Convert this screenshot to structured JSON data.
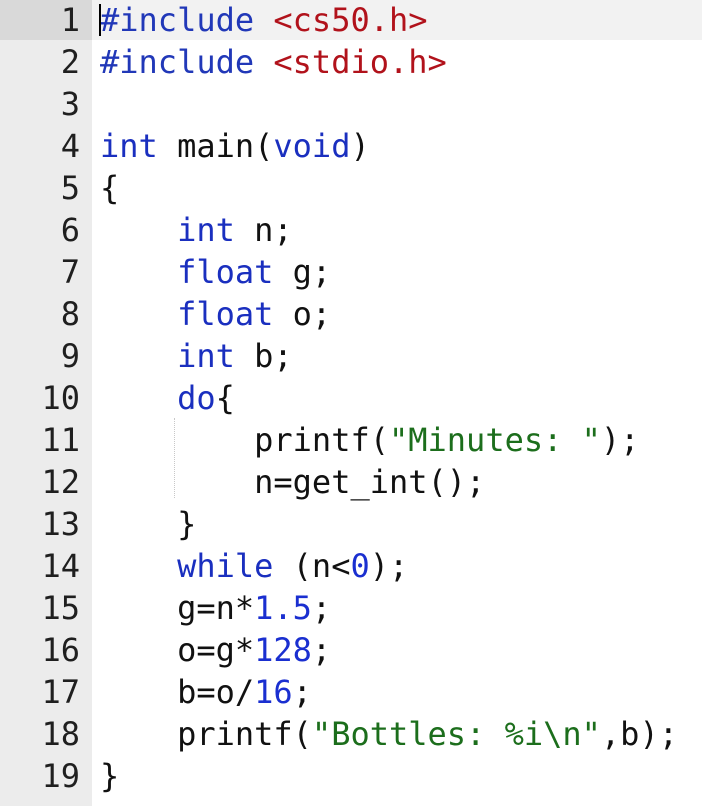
{
  "editor": {
    "language": "c",
    "lines": [
      {
        "number": "1",
        "tokens": [
          {
            "t": "#include ",
            "c": "inc"
          },
          {
            "t": "<cs50.h>",
            "c": "str"
          }
        ]
      },
      {
        "number": "2",
        "tokens": [
          {
            "t": "#include ",
            "c": "inc"
          },
          {
            "t": "<stdio.h>",
            "c": "str"
          }
        ]
      },
      {
        "number": "3",
        "tokens": []
      },
      {
        "number": "4",
        "tokens": [
          {
            "t": "int",
            "c": "kw"
          },
          {
            "t": " main(",
            "c": "plain"
          },
          {
            "t": "void",
            "c": "kw"
          },
          {
            "t": ")",
            "c": "plain"
          }
        ]
      },
      {
        "number": "5",
        "tokens": [
          {
            "t": "{",
            "c": "plain"
          }
        ]
      },
      {
        "number": "6",
        "tokens": [
          {
            "t": "    ",
            "c": "plain"
          },
          {
            "t": "int",
            "c": "kw"
          },
          {
            "t": " n;",
            "c": "plain"
          }
        ]
      },
      {
        "number": "7",
        "tokens": [
          {
            "t": "    ",
            "c": "plain"
          },
          {
            "t": "float",
            "c": "kw"
          },
          {
            "t": " g;",
            "c": "plain"
          }
        ]
      },
      {
        "number": "8",
        "tokens": [
          {
            "t": "    ",
            "c": "plain"
          },
          {
            "t": "float",
            "c": "kw"
          },
          {
            "t": " o;",
            "c": "plain"
          }
        ]
      },
      {
        "number": "9",
        "tokens": [
          {
            "t": "    ",
            "c": "plain"
          },
          {
            "t": "int",
            "c": "kw"
          },
          {
            "t": " b;",
            "c": "plain"
          }
        ]
      },
      {
        "number": "10",
        "tokens": [
          {
            "t": "    ",
            "c": "plain"
          },
          {
            "t": "do",
            "c": "kw"
          },
          {
            "t": "{",
            "c": "plain"
          }
        ]
      },
      {
        "number": "11",
        "tokens": [
          {
            "t": "        printf(",
            "c": "plain"
          },
          {
            "t": "\"Minutes: \"",
            "c": "s2"
          },
          {
            "t": ");",
            "c": "plain"
          }
        ]
      },
      {
        "number": "12",
        "tokens": [
          {
            "t": "        n=get_int();",
            "c": "plain"
          }
        ]
      },
      {
        "number": "13",
        "tokens": [
          {
            "t": "    }",
            "c": "plain"
          }
        ]
      },
      {
        "number": "14",
        "tokens": [
          {
            "t": "    ",
            "c": "plain"
          },
          {
            "t": "while",
            "c": "kw"
          },
          {
            "t": " (n<",
            "c": "plain"
          },
          {
            "t": "0",
            "c": "num"
          },
          {
            "t": ");",
            "c": "plain"
          }
        ]
      },
      {
        "number": "15",
        "tokens": [
          {
            "t": "    g=n*",
            "c": "plain"
          },
          {
            "t": "1.5",
            "c": "num"
          },
          {
            "t": ";",
            "c": "plain"
          }
        ]
      },
      {
        "number": "16",
        "tokens": [
          {
            "t": "    o=g*",
            "c": "plain"
          },
          {
            "t": "128",
            "c": "num"
          },
          {
            "t": ";",
            "c": "plain"
          }
        ]
      },
      {
        "number": "17",
        "tokens": [
          {
            "t": "    b=o/",
            "c": "plain"
          },
          {
            "t": "16",
            "c": "num"
          },
          {
            "t": ";",
            "c": "plain"
          }
        ]
      },
      {
        "number": "18",
        "tokens": [
          {
            "t": "    printf(",
            "c": "plain"
          },
          {
            "t": "\"Bottles: %i\\n\"",
            "c": "s2"
          },
          {
            "t": ",b);",
            "c": "plain"
          }
        ]
      },
      {
        "number": "19",
        "tokens": [
          {
            "t": "}",
            "c": "plain"
          }
        ]
      }
    ]
  }
}
